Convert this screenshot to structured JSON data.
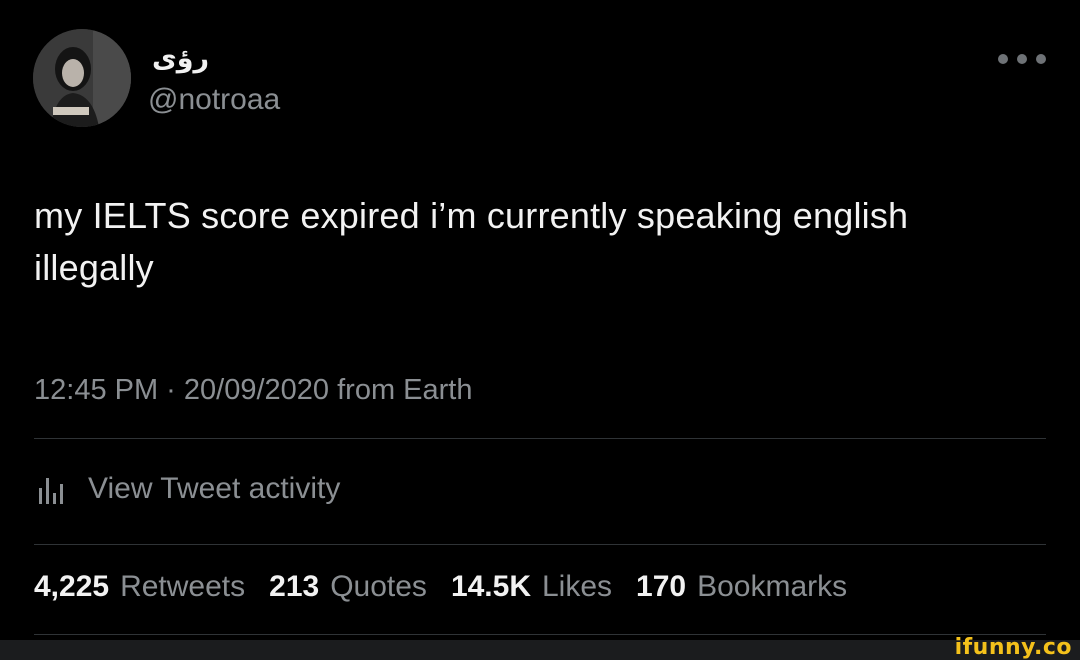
{
  "tweet": {
    "display_name": "رؤى",
    "handle": "@notroaa",
    "text": "my IELTS score expired i’m currently speaking english illegally",
    "meta": "12:45 PM · 20/09/2020 from Earth",
    "more_icon": "more-horizontal-icon"
  },
  "activity": {
    "icon": "bar-chart-icon",
    "label": "View Tweet activity"
  },
  "stats": [
    {
      "value": "4,225",
      "label": "Retweets"
    },
    {
      "value": "213",
      "label": "Quotes"
    },
    {
      "value": "14.5K",
      "label": "Likes"
    },
    {
      "value": "170",
      "label": "Bookmarks"
    }
  ],
  "watermark": {
    "text": "ifunny.co",
    "color": "#f4c11b"
  },
  "colors": {
    "background": "#000000",
    "primary_text": "#f2f2f2",
    "secondary_text": "#8b8f93",
    "divider": "#2f3336"
  }
}
